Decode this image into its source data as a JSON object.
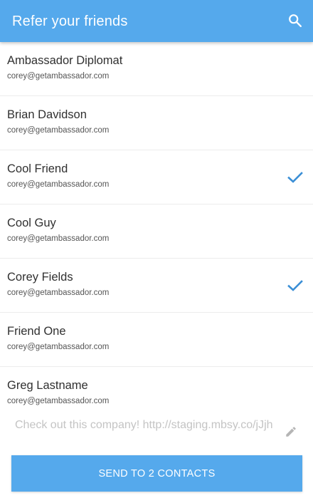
{
  "app_bar": {
    "title": "Refer your friends",
    "search_icon": "search-icon",
    "color": "#55a9ec"
  },
  "contacts": [
    {
      "name": "Ambassador Diplomat",
      "email": "corey@getambassador.com",
      "selected": false
    },
    {
      "name": "Brian Davidson",
      "email": "corey@getambassador.com",
      "selected": false
    },
    {
      "name": "Cool Friend",
      "email": "corey@getambassador.com",
      "selected": true
    },
    {
      "name": "Cool Guy",
      "email": "corey@getambassador.com",
      "selected": false
    },
    {
      "name": "Corey Fields",
      "email": "corey@getambassador.com",
      "selected": true
    },
    {
      "name": "Friend One",
      "email": "corey@getambassador.com",
      "selected": false
    },
    {
      "name": "Greg Lastname",
      "email": "corey@getambassador.com",
      "selected": false
    }
  ],
  "message": {
    "text": "Check out this company! http://staging.mbsy.co/jJjh",
    "edit_icon": "pencil-icon"
  },
  "send_button": {
    "label": "SEND TO 2 CONTACTS"
  },
  "colors": {
    "accent": "#55a9ec",
    "check": "#3b8fd6"
  }
}
